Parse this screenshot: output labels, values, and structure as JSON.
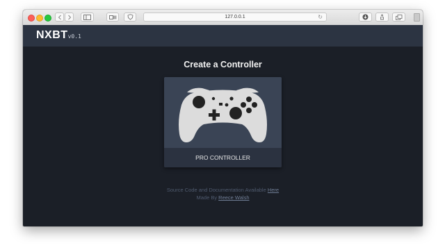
{
  "browser": {
    "url": "127.0.0.1",
    "reload_icon": "↻"
  },
  "app": {
    "brand": "NXBT",
    "version": "v0.1"
  },
  "main": {
    "heading": "Create a Controller",
    "card_label": "PRO CONTROLLER"
  },
  "footer": {
    "line1_text": "Source Code and Documentation Available ",
    "line1_link": "Here",
    "line2_text": "Made By ",
    "line2_link": "Reece Walsh"
  },
  "colors": {
    "background": "#1b1f27",
    "header": "#2c3442",
    "card": "#36404f",
    "controller_body": "#dcdcdc",
    "controller_buttons": "#222222"
  }
}
